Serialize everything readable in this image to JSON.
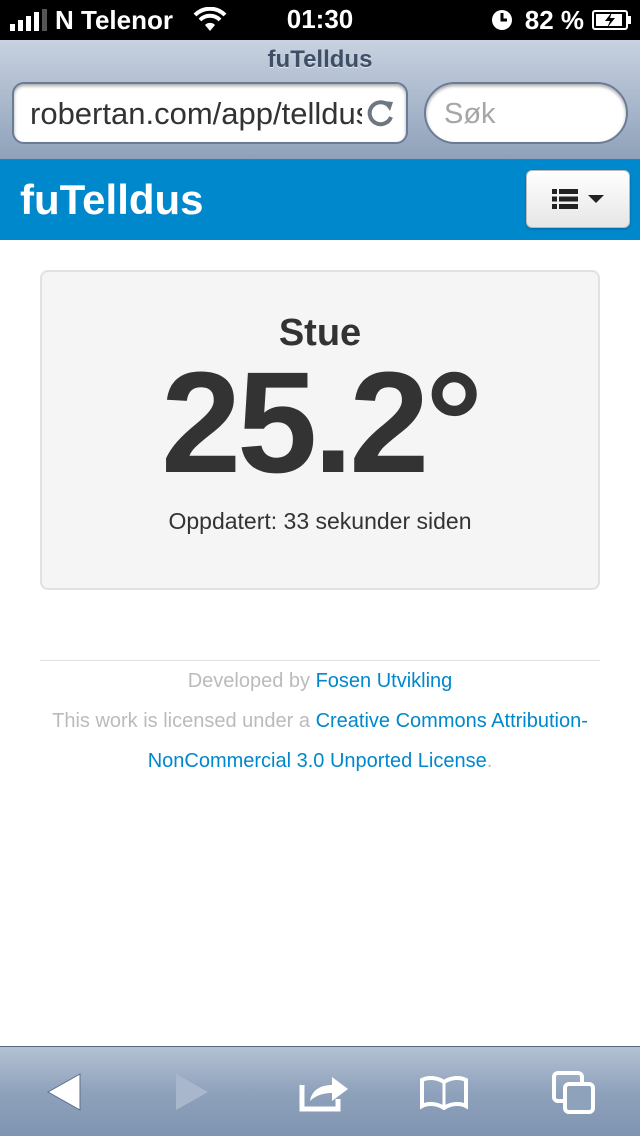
{
  "status_bar": {
    "carrier": "N Telenor",
    "time": "01:30",
    "battery_percent": "82 %"
  },
  "browser": {
    "page_title": "fuTelldus",
    "url": "robertan.com/app/telldus",
    "search_placeholder": "Søk"
  },
  "navbar": {
    "brand": "fuTelldus"
  },
  "sensor": {
    "name": "Stue",
    "temperature": "25.2°",
    "updated": "Oppdatert: 33 sekunder siden"
  },
  "footer": {
    "developed_prefix": "Developed by ",
    "developer_link": "Fosen Utvikling",
    "license_prefix": "This work is licensed under a ",
    "license_link_part1": "Creative Commons Attribution-",
    "license_link_part2": "NonCommercial 3.0 Unported License",
    "license_suffix": "."
  },
  "icons": {
    "signal": "signal-bars-icon",
    "wifi": "wifi-icon",
    "rotation_lock": "rotation-lock-icon",
    "battery": "battery-charging-icon",
    "reload": "reload-icon",
    "menu": "list-icon",
    "caret": "caret-down-icon",
    "back": "back-arrow-icon",
    "forward": "forward-arrow-icon",
    "share": "share-icon",
    "bookmarks": "bookmarks-icon",
    "tabs": "tabs-icon"
  },
  "colors": {
    "navbar": "#0088cc",
    "link": "#0088cc",
    "card_background": "#f5f5f5"
  }
}
